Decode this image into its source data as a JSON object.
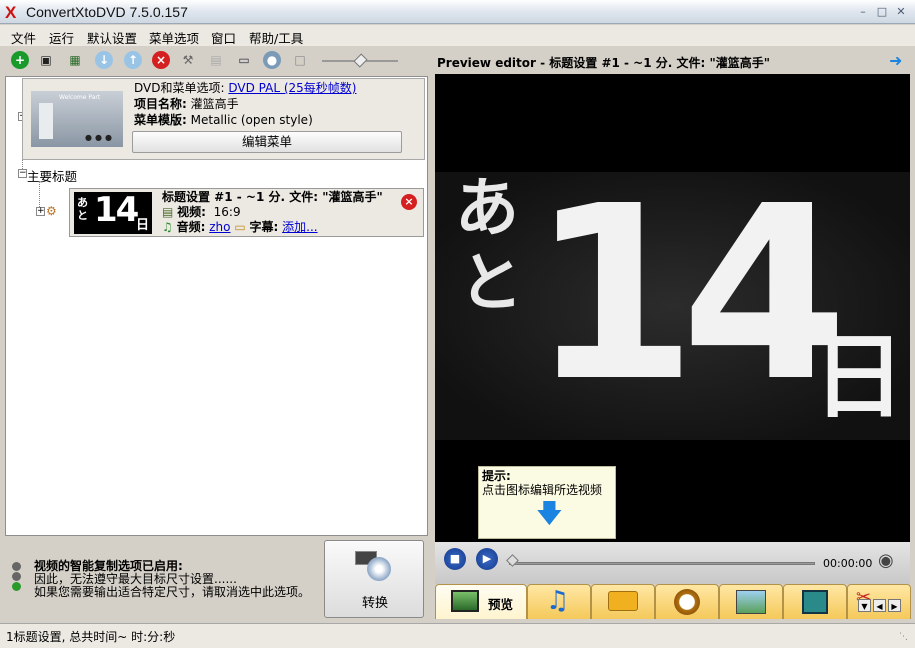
{
  "window": {
    "title": "ConvertXtoDVD 7.5.0.157",
    "logo": "X"
  },
  "menu": [
    "文件",
    "运行",
    "默认设置",
    "菜单选项",
    "窗口",
    "帮助/工具"
  ],
  "dvd": {
    "options_label": "DVD和菜单选项:",
    "options_value": "DVD PAL (25每秒帧数)",
    "project_label": "项目名称:",
    "project_value": "灌篮高手",
    "template_label": "菜单模版:",
    "template_value": "Metallic (open style)",
    "edit_menu_button": "编辑菜单",
    "thumb_caption": "Welcome Part"
  },
  "tree": {
    "main_titles": "主要标题"
  },
  "title_item": {
    "thumb_kana": "あと",
    "thumb_number": "14",
    "thumb_day": "日",
    "heading": "标题设置 #1 - ~1 分. 文件: \"灌篮高手\"",
    "video_label": "视频:",
    "video_value": "16:9",
    "audio_label": "音频:",
    "audio_value": "zho",
    "subtitle_label": "字幕:",
    "subtitle_value": "添加..."
  },
  "smart_copy": {
    "line1": "视频的智能复制选项已启用:",
    "line2": "因此，无法遵守最大目标尺寸设置......",
    "line3": "如果您需要输出适合特定尺寸，请取消选中此选项。"
  },
  "convert_button": "转换",
  "preview": {
    "header": "Preview editor - 标题设置 #1 - ~1 分. 文件: \"灌篮高手\"",
    "kana1": "あ",
    "kana2": "と",
    "number": "14",
    "day": "日",
    "tip_title": "提示:",
    "tip_text": "点击图标编辑所选视频",
    "time": "00:00:00"
  },
  "tabs": {
    "preview_label": "预览"
  },
  "status": "1标题设置, 总共时间~ 时:分:秒",
  "colors": {
    "add": "#1a9a2a",
    "remove": "#d42020",
    "link": "#0000d0",
    "arrow": "#1a84e0"
  }
}
